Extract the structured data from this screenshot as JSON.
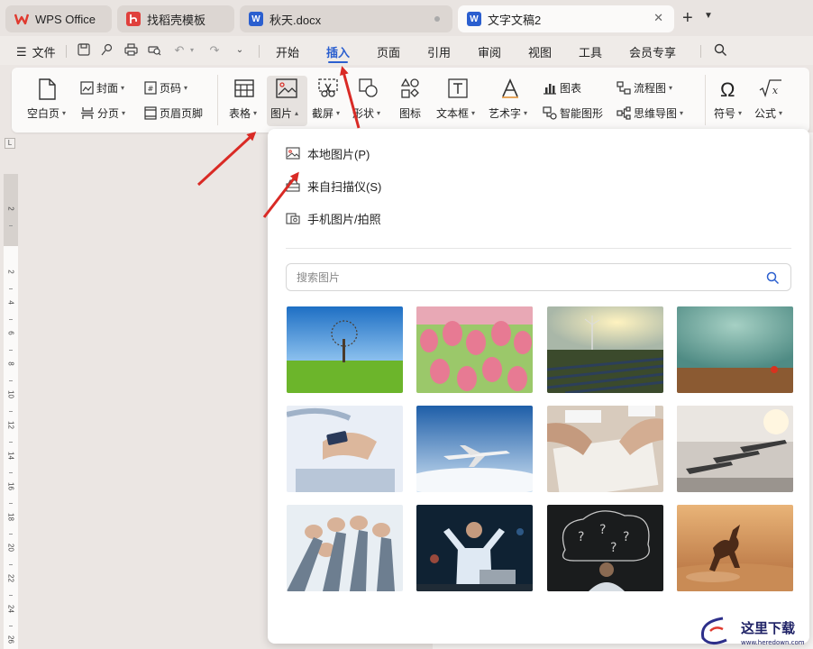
{
  "tabs": [
    {
      "label": "WPS Office",
      "icon": "wps-logo-icon",
      "color": "#e03a2f"
    },
    {
      "label": "找稻壳模板",
      "icon": "docer-icon",
      "color": "#e0403c"
    },
    {
      "label": "秋天.docx",
      "icon": "word-doc-icon",
      "color": "#2b5fcf"
    },
    {
      "label": "文字文稿2",
      "icon": "word-doc-icon",
      "color": "#2b5fcf"
    }
  ],
  "menubar": {
    "file": "文件",
    "items": [
      "开始",
      "插入",
      "页面",
      "引用",
      "审阅",
      "视图",
      "工具",
      "会员专享"
    ],
    "active": "插入"
  },
  "ribbon": {
    "blank_page": "空白页",
    "cover": "封面",
    "page_break": "分页",
    "page_number": "页码",
    "header_footer": "页眉页脚",
    "table": "表格",
    "picture": "图片",
    "screenshot": "截屏",
    "shape": "形状",
    "icon": "图标",
    "textbox": "文本框",
    "wordart": "艺术字",
    "chart": "图表",
    "smartart": "智能图形",
    "flowchart": "流程图",
    "mindmap": "思维导图",
    "symbol": "符号",
    "formula": "公式"
  },
  "picture_menu": {
    "options": [
      "本地图片(P)",
      "来自扫描仪(S)",
      "手机图片/拍照"
    ],
    "search_placeholder": "搜索图片",
    "thumbnails": [
      "lone-tree-field",
      "pink-tulips",
      "solar-farm-sunset",
      "teal-wall-apple",
      "hands-phone-laptop",
      "airplane-sky",
      "signing-document",
      "gym-treadmills",
      "raised-fists-team",
      "businessman-celebrating",
      "question-marks-chalkboard",
      "horse-running-desert"
    ]
  },
  "ruler_numbers": [
    "2",
    "2",
    "4",
    "6",
    "8",
    "10",
    "12",
    "14",
    "16",
    "18",
    "20",
    "22",
    "24",
    "26"
  ],
  "watermark": {
    "title": "这里下载",
    "url": "www.heredown.com"
  },
  "colors": {
    "accent": "#2b5fcf",
    "arrow": "#d92a25"
  }
}
